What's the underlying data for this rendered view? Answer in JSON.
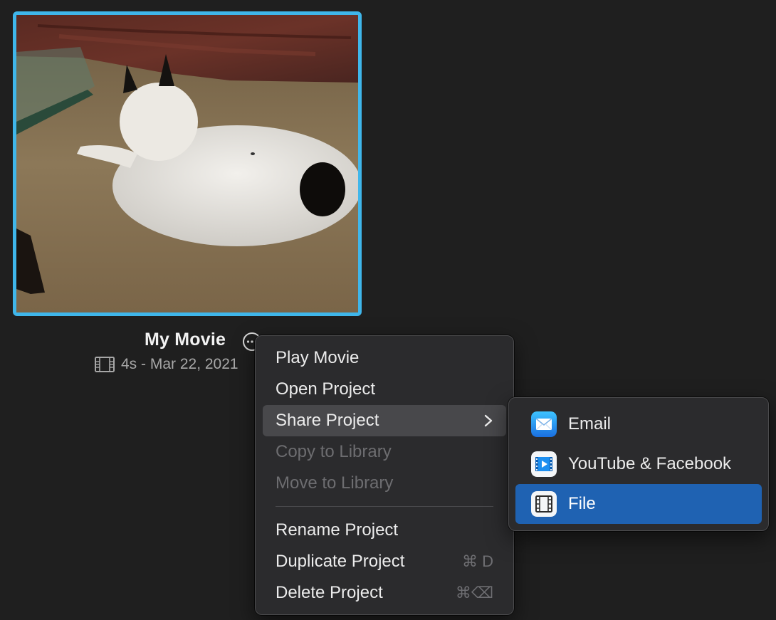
{
  "project": {
    "title": "My Movie",
    "meta": "4s - Mar 22, 2021"
  },
  "colors": {
    "selection_border": "#3fb6ea",
    "menu_highlight": "#48484b",
    "submenu_selected": "#1f62b2"
  },
  "context_menu": {
    "items": [
      {
        "label": "Play Movie"
      },
      {
        "label": "Open Project"
      },
      {
        "label": "Share Project",
        "has_submenu": true
      },
      {
        "label": "Copy to Library",
        "disabled": true
      },
      {
        "label": "Move to Library",
        "disabled": true
      },
      {
        "label": "Rename Project"
      },
      {
        "label": "Duplicate Project",
        "shortcut": "⌘ D"
      },
      {
        "label": "Delete Project",
        "shortcut": "⌘⌫"
      }
    ]
  },
  "share_submenu": {
    "items": [
      {
        "label": "Email",
        "icon": "mail-icon"
      },
      {
        "label": "YouTube & Facebook",
        "icon": "video-share-icon"
      },
      {
        "label": "File",
        "icon": "film-file-icon",
        "selected": true
      }
    ]
  }
}
